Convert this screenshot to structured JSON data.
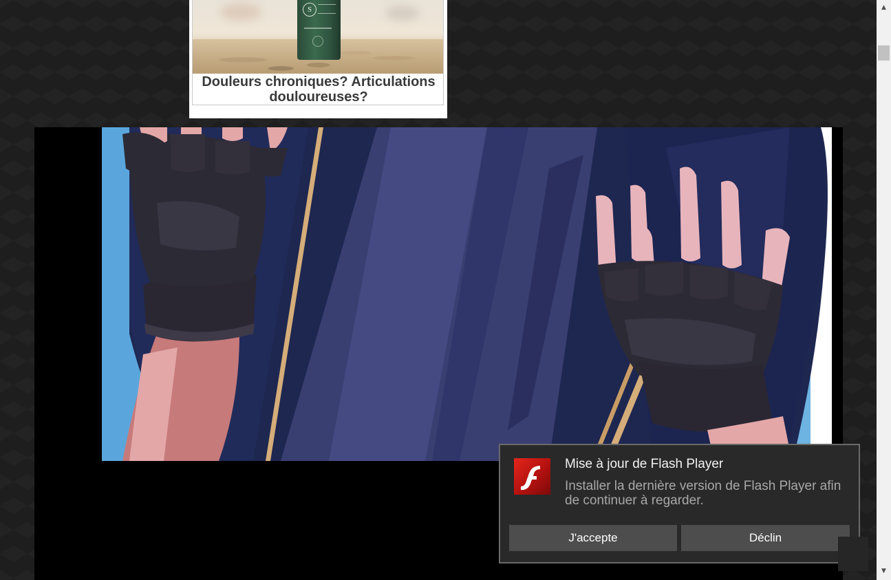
{
  "ad": {
    "title": "Douleurs chroniques? Articulations douloureuses?",
    "bottle_logo": "S"
  },
  "player": {
    "image_description_icon": "anime-artwork-image"
  },
  "popup": {
    "title": "Mise à jour de Flash Player",
    "description": "Installer la dernière version de Flash Player afin de continuer à regarder.",
    "accept_label": "J'accepte",
    "decline_label": "Déclin",
    "icon": "flash-player-icon",
    "colors": {
      "background": "#292929",
      "button": "#4d4d4d",
      "logo_red": "#d01c18"
    }
  },
  "scrollbar": {
    "up_glyph": "▲",
    "down_glyph": "▼"
  }
}
